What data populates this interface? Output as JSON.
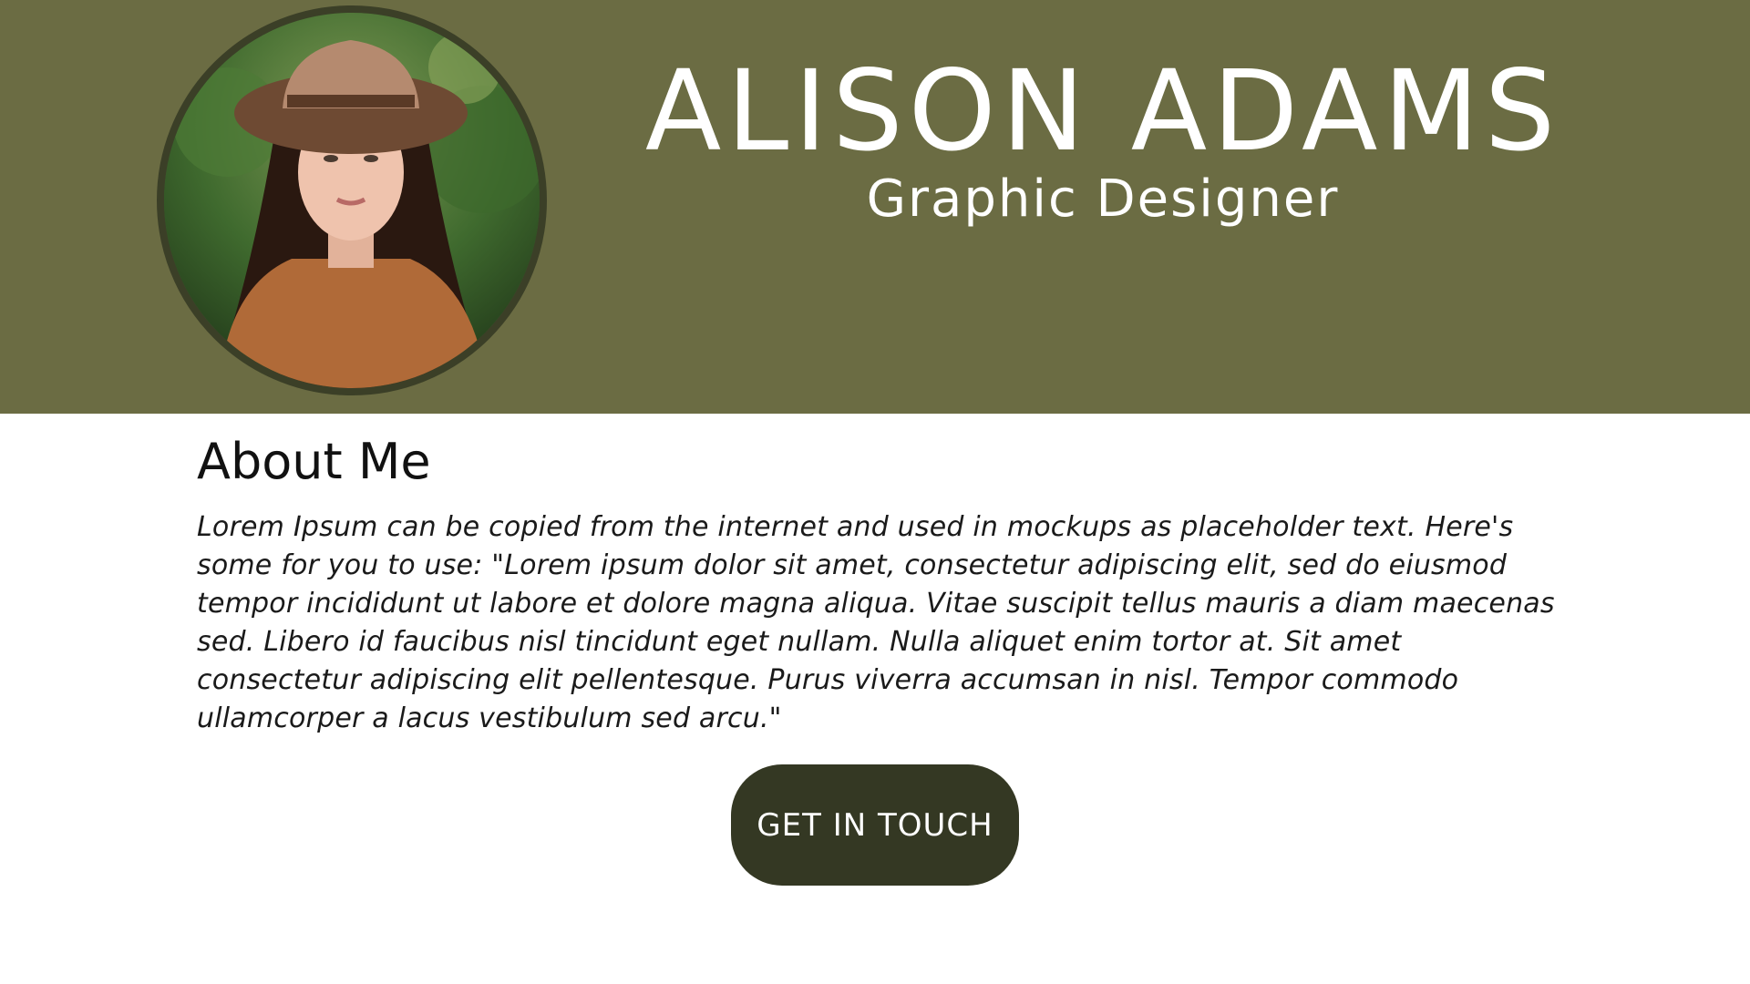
{
  "profile": {
    "name": "ALISON ADAMS",
    "title": "Graphic Designer",
    "photo_icon": "portrait-photo"
  },
  "about": {
    "heading": "About Me",
    "text": "Lorem Ipsum can be copied from the internet and used in mockups as placeholder text. Here's some for you to use: \"Lorem ipsum dolor sit amet, consectetur adipiscing elit, sed do eiusmod tempor incididunt ut labore et dolore magna aliqua. Vitae suscipit tellus mauris a diam maecenas sed. Libero id faucibus nisl tincidunt eget nullam. Nulla aliquet enim tortor at. Sit amet consectetur adipiscing elit pellentesque. Purus viverra accumsan in nisl. Tempor commodo ullamcorper a lacus vestibulum sed arcu.\""
  },
  "cta": {
    "label": "GET IN TOUCH"
  },
  "colors": {
    "header_bg": "#6b6c43",
    "avatar_border": "#3b3f27",
    "button_bg": "#343823",
    "text_light": "#ffffff",
    "text_dark": "#111111"
  }
}
